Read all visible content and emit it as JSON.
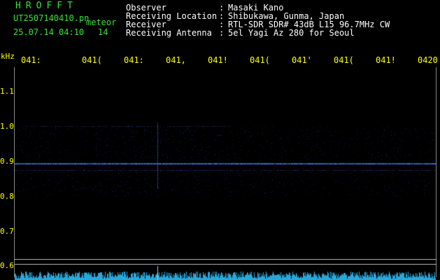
{
  "header": {
    "app_title": "HROFFT",
    "file_name": "UT2507140410.pn",
    "mode": "meteor",
    "date_time": "25.07.14 04:10",
    "count": "14"
  },
  "station_info": [
    {
      "label": "Observer",
      "value": "Masaki Kano"
    },
    {
      "label": "Receiving Location",
      "value": "Shibukawa, Gunma, Japan"
    },
    {
      "label": "Receiver",
      "value": "RTL-SDR SDR# 43dB L15 96.7MHz CW"
    },
    {
      "label": "Receiving Antenna",
      "value": "5el Yagi Az 280 for Seoul"
    }
  ],
  "axes": {
    "y_unit": "kHz",
    "y_ticks": [
      "1.1",
      "1.0",
      "0.9",
      "0.8",
      "0.7",
      "0.6"
    ],
    "time_ticks": [
      "041:",
      "041(",
      "041:",
      "041,",
      "041!",
      "041(",
      "041'",
      "041(",
      "041!",
      "0420"
    ]
  },
  "colors": {
    "background": "#000000",
    "title_green": "#39e23a",
    "text_white": "#ffffff",
    "tick_yellow": "#ffff00",
    "signal_blue": "#4a6bff",
    "trace_cyan": "#2aa7d8"
  },
  "signal": {
    "carrier_khz": 0.895,
    "secondary_khz": 0.875,
    "band_top_khz": 1.0,
    "band_bottom_khz": 0.8
  }
}
